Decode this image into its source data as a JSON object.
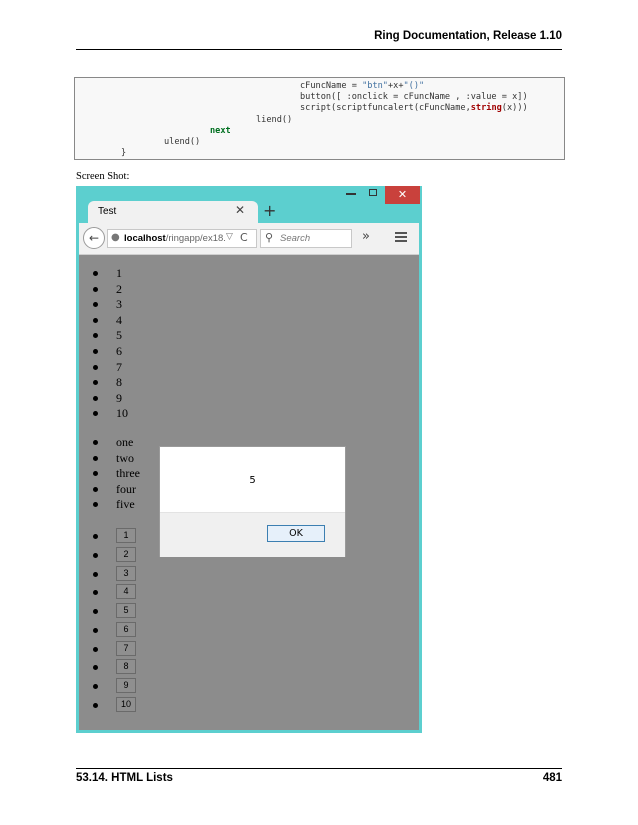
{
  "header": {
    "running_title": "Ring Documentation, Release 1.10"
  },
  "code": {
    "line1": {
      "a": "cFuncName = ",
      "b": "\"btn\"",
      "c": "+x+",
      "d": "\"()\""
    },
    "line2": "button([ :onclick = cFuncName , :value = x])",
    "line3": {
      "a": "script(scriptfuncalert(cFuncName,",
      "b": "string",
      "c": "(x)))"
    },
    "line4": "liend()",
    "line5": "next",
    "line6": "ulend()",
    "line7": "}"
  },
  "caption": "Screen Shot:",
  "browser": {
    "close_glyph": "✕",
    "tab_title": "Test",
    "tab_close_glyph": "✕",
    "new_tab_glyph": "+",
    "back_glyph": "←",
    "url_host": "localhost",
    "url_path": "/ringapp/ex18.",
    "url_dropdown_glyph": "▽",
    "reload_glyph": "C",
    "search_placeholder": "Search",
    "overflow_glyph": "»",
    "icons": [
      "minimize-icon",
      "maximize-icon",
      "close-icon",
      "tab-close-icon",
      "new-tab-icon",
      "back-arrow-icon",
      "globe-icon",
      "reload-icon",
      "search-icon",
      "overflow-icon",
      "menu-icon"
    ]
  },
  "page": {
    "numbers": [
      "1",
      "2",
      "3",
      "4",
      "5",
      "6",
      "7",
      "8",
      "9",
      "10"
    ],
    "words": [
      "one",
      "two",
      "three",
      "four",
      "five"
    ],
    "buttons": [
      "1",
      "2",
      "3",
      "4",
      "5",
      "6",
      "7",
      "8",
      "9",
      "10"
    ]
  },
  "alert": {
    "message": "5",
    "ok_label": "OK"
  },
  "footer": {
    "section": "53.14. HTML Lists",
    "page_number": "481"
  }
}
